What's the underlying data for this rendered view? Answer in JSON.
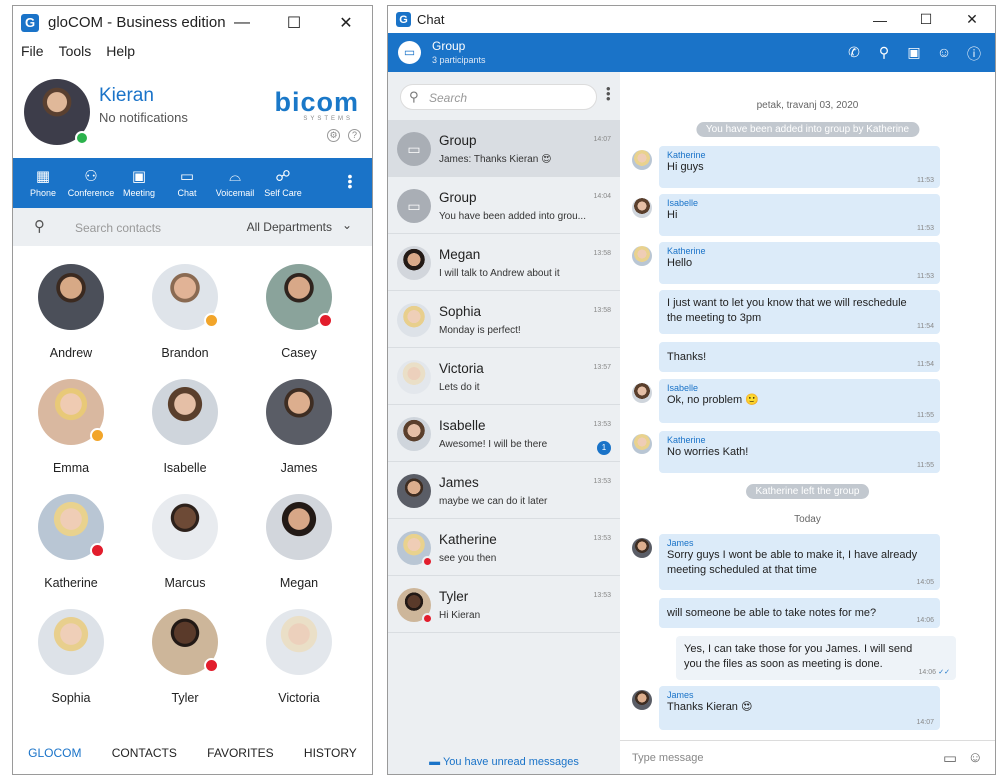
{
  "left_window": {
    "title": "gloCOM - Business edition",
    "logo_letter": "G",
    "controls": {
      "minimize": "—",
      "maximize": "☐",
      "close": "✕"
    },
    "menu": [
      "File",
      "Tools",
      "Help"
    ],
    "profile": {
      "name": "Kieran",
      "notifications": "No notifications",
      "brand": "bicom",
      "brand_sub": "SYSTEMS",
      "settings_icon": "⚙",
      "help_icon": "?"
    },
    "toolbar": [
      {
        "icon": "▦",
        "label": "Phone"
      },
      {
        "icon": "⚇",
        "label": "Conference"
      },
      {
        "icon": "▣",
        "label": "Meeting"
      },
      {
        "icon": "▭",
        "label": "Chat"
      },
      {
        "icon": "⌓",
        "label": "Voicemail"
      },
      {
        "icon": "☍",
        "label": "Self Care"
      }
    ],
    "more_icon": "⋮",
    "search": {
      "icon": "⚲",
      "placeholder": "Search contacts",
      "department": "All Departments",
      "chevron": "⌄"
    },
    "contacts": [
      {
        "name": "Andrew",
        "status": ""
      },
      {
        "name": "Brandon",
        "status": "away"
      },
      {
        "name": "Casey",
        "status": "busy"
      },
      {
        "name": "Emma",
        "status": "away"
      },
      {
        "name": "Isabelle",
        "status": ""
      },
      {
        "name": "James",
        "status": ""
      },
      {
        "name": "Katherine",
        "status": "dnd"
      },
      {
        "name": "Marcus",
        "status": ""
      },
      {
        "name": "Megan",
        "status": ""
      },
      {
        "name": "Sophia",
        "status": ""
      },
      {
        "name": "Tyler",
        "status": "dnd"
      },
      {
        "name": "Victoria",
        "status": ""
      }
    ],
    "bottom_nav": [
      "GLOCOM",
      "CONTACTS",
      "FAVORITES",
      "HISTORY"
    ]
  },
  "chat_window": {
    "title": "Chat",
    "logo_letter": "G",
    "controls": {
      "minimize": "—",
      "maximize": "☐",
      "close": "✕"
    },
    "header": {
      "name": "Group",
      "subtitle": "3 participants",
      "icons": [
        "✆",
        "⚲",
        "▣",
        "☺",
        "ⓘ"
      ]
    },
    "search_placeholder": "Search",
    "search_icon": "⚲",
    "more_icon": "⋮",
    "conversations": [
      {
        "title": "Group",
        "preview": "James: Thanks Kieran 😍",
        "time": "14:07",
        "type": "group",
        "selected": true
      },
      {
        "title": "Group",
        "preview": "You have been added into grou...",
        "time": "14:04",
        "type": "group"
      },
      {
        "title": "Megan",
        "preview": "I will talk to Andrew about it",
        "time": "13:58"
      },
      {
        "title": "Sophia",
        "preview": "Monday is perfect!",
        "time": "13:58"
      },
      {
        "title": "Victoria",
        "preview": "Lets do it",
        "time": "13:57"
      },
      {
        "title": "Isabelle",
        "preview": "Awesome! I will be there",
        "time": "13:53",
        "unread": "1"
      },
      {
        "title": "James",
        "preview": "maybe we can do it later",
        "time": "13:53"
      },
      {
        "title": "Katherine",
        "preview": "see you then",
        "time": "13:53",
        "status": "dnd"
      },
      {
        "title": "Tyler",
        "preview": "Hi Kieran",
        "time": "13:53",
        "status": "dnd"
      }
    ],
    "unread_footer": "You have unread messages",
    "date_header": "petak, travanj 03, 2020",
    "system_added": "You have been added into group by Katherine",
    "system_left": "Katherine left the group",
    "today": "Today",
    "messages": [
      {
        "from": "Katherine",
        "text": "Hi guys",
        "time": "11:53"
      },
      {
        "from": "Isabelle",
        "text": "Hi",
        "time": "11:53"
      },
      {
        "from": "Katherine",
        "text": "Hello",
        "time": "11:53"
      },
      {
        "from": "",
        "text": "I just want to let you know that we will reschedule",
        "text2": "the meeting to 3pm",
        "time": "11:54"
      },
      {
        "from": "",
        "text": "Thanks!",
        "time": "11:54"
      },
      {
        "from": "Isabelle",
        "text": "Ok, no problem 🙂",
        "time": "11:55"
      },
      {
        "from": "Katherine",
        "text": "No worries Kath!",
        "time": "11:55"
      },
      {
        "from": "James",
        "text": "Sorry guys I wont be able to make it, I have already",
        "text2": "meeting scheduled at that time",
        "time": "14:05"
      },
      {
        "from": "",
        "text": "will someone be able to take notes for me?",
        "time": "14:06"
      },
      {
        "from": "",
        "text": "Yes, I can take those for you James. I will send",
        "text2": "you the files as soon as meeting is done.",
        "time": "14:06",
        "ticks": "✓✓"
      },
      {
        "from": "James",
        "text": "Thanks Kieran 😍",
        "time": "14:07"
      }
    ],
    "composer_placeholder": "Type message",
    "attach_icon": "▭",
    "emoji_icon": "☺"
  }
}
